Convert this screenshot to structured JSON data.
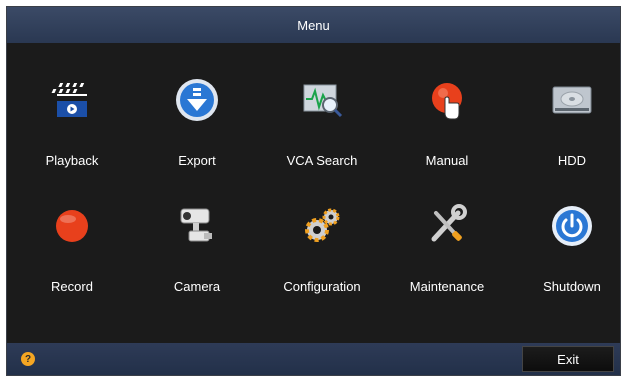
{
  "window": {
    "title": "Menu"
  },
  "tiles": [
    {
      "label": "Playback",
      "icon": "playback-clapper-icon"
    },
    {
      "label": "Export",
      "icon": "export-download-icon"
    },
    {
      "label": "VCA Search",
      "icon": "vca-search-icon"
    },
    {
      "label": "Manual",
      "icon": "manual-record-icon"
    },
    {
      "label": "HDD",
      "icon": "hdd-icon"
    },
    {
      "label": "Record",
      "icon": "record-icon"
    },
    {
      "label": "Camera",
      "icon": "camera-icon"
    },
    {
      "label": "Configuration",
      "icon": "configuration-gears-icon"
    },
    {
      "label": "Maintenance",
      "icon": "maintenance-tools-icon"
    },
    {
      "label": "Shutdown",
      "icon": "power-icon"
    }
  ],
  "statusbar": {
    "help_glyph": "?",
    "exit_label": "Exit"
  },
  "colors": {
    "accent_blue": "#2a77d4",
    "record_red": "#e8401c",
    "help_orange": "#f5a623"
  }
}
